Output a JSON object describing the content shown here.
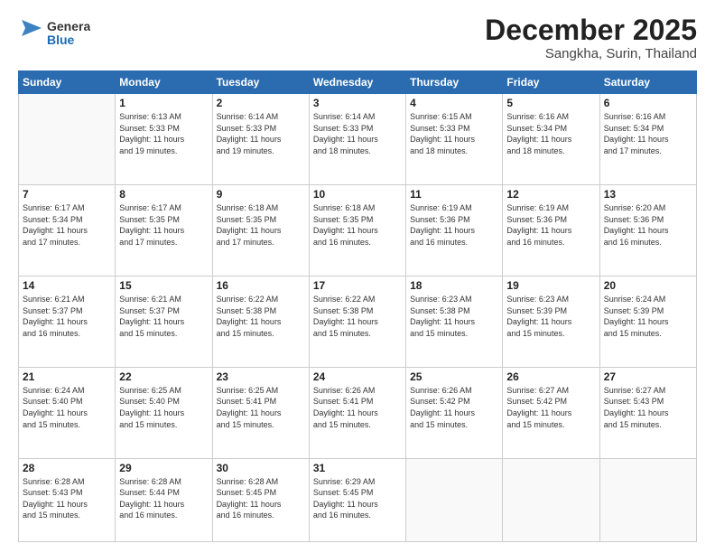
{
  "header": {
    "logo_line1": "General",
    "logo_line2": "Blue",
    "title": "December 2025",
    "subtitle": "Sangkha, Surin, Thailand"
  },
  "weekdays": [
    "Sunday",
    "Monday",
    "Tuesday",
    "Wednesday",
    "Thursday",
    "Friday",
    "Saturday"
  ],
  "weeks": [
    [
      {
        "day": "",
        "info": ""
      },
      {
        "day": "1",
        "info": "Sunrise: 6:13 AM\nSunset: 5:33 PM\nDaylight: 11 hours\nand 19 minutes."
      },
      {
        "day": "2",
        "info": "Sunrise: 6:14 AM\nSunset: 5:33 PM\nDaylight: 11 hours\nand 19 minutes."
      },
      {
        "day": "3",
        "info": "Sunrise: 6:14 AM\nSunset: 5:33 PM\nDaylight: 11 hours\nand 18 minutes."
      },
      {
        "day": "4",
        "info": "Sunrise: 6:15 AM\nSunset: 5:33 PM\nDaylight: 11 hours\nand 18 minutes."
      },
      {
        "day": "5",
        "info": "Sunrise: 6:16 AM\nSunset: 5:34 PM\nDaylight: 11 hours\nand 18 minutes."
      },
      {
        "day": "6",
        "info": "Sunrise: 6:16 AM\nSunset: 5:34 PM\nDaylight: 11 hours\nand 17 minutes."
      }
    ],
    [
      {
        "day": "7",
        "info": "Sunrise: 6:17 AM\nSunset: 5:34 PM\nDaylight: 11 hours\nand 17 minutes."
      },
      {
        "day": "8",
        "info": "Sunrise: 6:17 AM\nSunset: 5:35 PM\nDaylight: 11 hours\nand 17 minutes."
      },
      {
        "day": "9",
        "info": "Sunrise: 6:18 AM\nSunset: 5:35 PM\nDaylight: 11 hours\nand 17 minutes."
      },
      {
        "day": "10",
        "info": "Sunrise: 6:18 AM\nSunset: 5:35 PM\nDaylight: 11 hours\nand 16 minutes."
      },
      {
        "day": "11",
        "info": "Sunrise: 6:19 AM\nSunset: 5:36 PM\nDaylight: 11 hours\nand 16 minutes."
      },
      {
        "day": "12",
        "info": "Sunrise: 6:19 AM\nSunset: 5:36 PM\nDaylight: 11 hours\nand 16 minutes."
      },
      {
        "day": "13",
        "info": "Sunrise: 6:20 AM\nSunset: 5:36 PM\nDaylight: 11 hours\nand 16 minutes."
      }
    ],
    [
      {
        "day": "14",
        "info": "Sunrise: 6:21 AM\nSunset: 5:37 PM\nDaylight: 11 hours\nand 16 minutes."
      },
      {
        "day": "15",
        "info": "Sunrise: 6:21 AM\nSunset: 5:37 PM\nDaylight: 11 hours\nand 15 minutes."
      },
      {
        "day": "16",
        "info": "Sunrise: 6:22 AM\nSunset: 5:38 PM\nDaylight: 11 hours\nand 15 minutes."
      },
      {
        "day": "17",
        "info": "Sunrise: 6:22 AM\nSunset: 5:38 PM\nDaylight: 11 hours\nand 15 minutes."
      },
      {
        "day": "18",
        "info": "Sunrise: 6:23 AM\nSunset: 5:38 PM\nDaylight: 11 hours\nand 15 minutes."
      },
      {
        "day": "19",
        "info": "Sunrise: 6:23 AM\nSunset: 5:39 PM\nDaylight: 11 hours\nand 15 minutes."
      },
      {
        "day": "20",
        "info": "Sunrise: 6:24 AM\nSunset: 5:39 PM\nDaylight: 11 hours\nand 15 minutes."
      }
    ],
    [
      {
        "day": "21",
        "info": "Sunrise: 6:24 AM\nSunset: 5:40 PM\nDaylight: 11 hours\nand 15 minutes."
      },
      {
        "day": "22",
        "info": "Sunrise: 6:25 AM\nSunset: 5:40 PM\nDaylight: 11 hours\nand 15 minutes."
      },
      {
        "day": "23",
        "info": "Sunrise: 6:25 AM\nSunset: 5:41 PM\nDaylight: 11 hours\nand 15 minutes."
      },
      {
        "day": "24",
        "info": "Sunrise: 6:26 AM\nSunset: 5:41 PM\nDaylight: 11 hours\nand 15 minutes."
      },
      {
        "day": "25",
        "info": "Sunrise: 6:26 AM\nSunset: 5:42 PM\nDaylight: 11 hours\nand 15 minutes."
      },
      {
        "day": "26",
        "info": "Sunrise: 6:27 AM\nSunset: 5:42 PM\nDaylight: 11 hours\nand 15 minutes."
      },
      {
        "day": "27",
        "info": "Sunrise: 6:27 AM\nSunset: 5:43 PM\nDaylight: 11 hours\nand 15 minutes."
      }
    ],
    [
      {
        "day": "28",
        "info": "Sunrise: 6:28 AM\nSunset: 5:43 PM\nDaylight: 11 hours\nand 15 minutes."
      },
      {
        "day": "29",
        "info": "Sunrise: 6:28 AM\nSunset: 5:44 PM\nDaylight: 11 hours\nand 16 minutes."
      },
      {
        "day": "30",
        "info": "Sunrise: 6:28 AM\nSunset: 5:45 PM\nDaylight: 11 hours\nand 16 minutes."
      },
      {
        "day": "31",
        "info": "Sunrise: 6:29 AM\nSunset: 5:45 PM\nDaylight: 11 hours\nand 16 minutes."
      },
      {
        "day": "",
        "info": ""
      },
      {
        "day": "",
        "info": ""
      },
      {
        "day": "",
        "info": ""
      }
    ]
  ]
}
